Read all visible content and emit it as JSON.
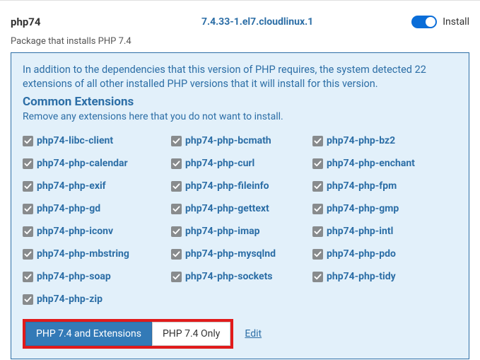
{
  "header": {
    "name": "php74",
    "version": "7.4.33-1.el7.cloudlinux.1",
    "toggle_on": true,
    "toggle_label": "Install"
  },
  "description": "Package that installs PHP 7.4",
  "panel": {
    "note": "In addition to the dependencies that this version of PHP requires, the system detected 22 extensions of all other installed PHP versions that it will install for this version.",
    "heading": "Common Extensions",
    "sub": "Remove any extensions here that you do not want to install.",
    "extensions": [
      "php74-libc-client",
      "php74-php-bcmath",
      "php74-php-bz2",
      "php74-php-calendar",
      "php74-php-curl",
      "php74-php-enchant",
      "php74-php-exif",
      "php74-php-fileinfo",
      "php74-php-fpm",
      "php74-php-gd",
      "php74-php-gettext",
      "php74-php-gmp",
      "php74-php-iconv",
      "php74-php-imap",
      "php74-php-intl",
      "php74-php-mbstring",
      "php74-php-mysqlnd",
      "php74-php-pdo",
      "php74-php-soap",
      "php74-php-sockets",
      "php74-php-tidy",
      "php74-php-zip"
    ],
    "buttons": {
      "primary": "PHP 7.4 and Extensions",
      "secondary": "PHP 7.4 Only",
      "edit": "Edit"
    }
  }
}
